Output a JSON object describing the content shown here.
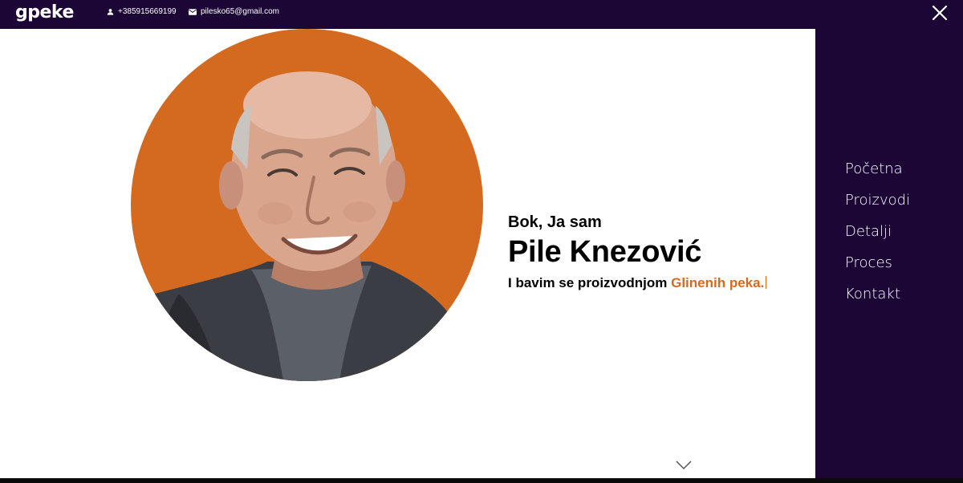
{
  "header": {
    "logo": "gpeke",
    "phone": "+385915669199",
    "email": "pilesko65@gmail.com",
    "phone_icon": "person-icon",
    "email_icon": "mail-icon",
    "close_icon": "close-icon"
  },
  "hero": {
    "greeting": "Bok, Ja sam",
    "name": "Pile Knezović",
    "tagline_prefix": "I bavim se proizvodnjom",
    "tagline_accent": "Glinenih peka.",
    "photo_icon": "profile-photo",
    "scroll_icon": "chevron-down-icon"
  },
  "sidebar": {
    "items": [
      {
        "label": "Početna"
      },
      {
        "label": "Proizvodi"
      },
      {
        "label": "Detalji"
      },
      {
        "label": "Proces"
      },
      {
        "label": "Kontakt"
      }
    ]
  },
  "colors": {
    "dark": "#1b0636",
    "accent": "#d46a1f",
    "background": "#ffffff"
  }
}
